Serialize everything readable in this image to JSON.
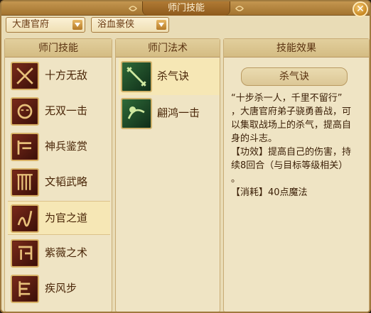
{
  "window": {
    "title": "师门技能",
    "close_icon": "close-icon"
  },
  "filters": {
    "school": "大唐官府",
    "category": "浴血豪侠"
  },
  "panels": {
    "skills_header": "师门技能",
    "spells_header": "师门法术",
    "effect_header": "技能效果"
  },
  "skills": [
    {
      "label": "十方无敌",
      "icon": "crossed-blades-icon",
      "selected": false
    },
    {
      "label": "无双一击",
      "icon": "warrior-mask-icon",
      "selected": false
    },
    {
      "label": "神兵鉴赏",
      "icon": "weapon-rack-icon",
      "selected": false
    },
    {
      "label": "文韬武略",
      "icon": "scroll-icon",
      "selected": false
    },
    {
      "label": "为官之道",
      "icon": "official-seal-icon",
      "selected": true
    },
    {
      "label": "紫薇之术",
      "icon": "star-chart-icon",
      "selected": false
    },
    {
      "label": "疾风步",
      "icon": "swift-step-icon",
      "selected": false
    }
  ],
  "spells": [
    {
      "label": "杀气诀",
      "icon": "killing-aura-icon",
      "selected": true
    },
    {
      "label": "翩鸿一击",
      "icon": "swan-strike-icon",
      "selected": false
    }
  ],
  "effect": {
    "name": "杀气诀",
    "lines": [
      "“十步杀一人，千里不留行”",
      "，大唐官府弟子骁勇善战，可",
      "以集取战场上的杀气，提高自",
      "身的斗志。",
      "【功效】提高自己的伤害，持",
      "续8回合（与目标等级相关）",
      "。",
      "【消耗】40点魔法"
    ]
  },
  "colors": {
    "panel_bg": "#efe4c4",
    "title_bar": "#a3742f",
    "selected_row": "#f6e7b5"
  }
}
